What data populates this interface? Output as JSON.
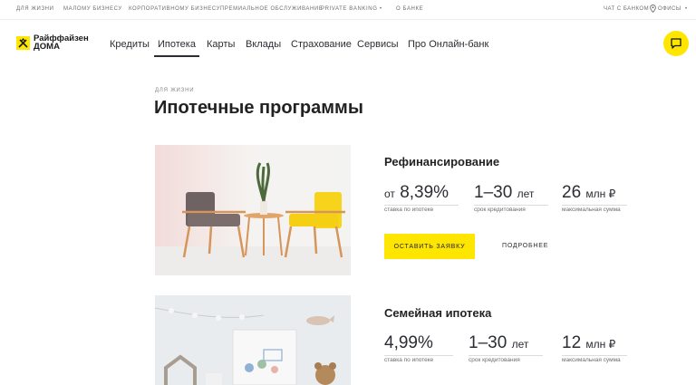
{
  "topbar": {
    "items": [
      "Для жизни",
      "Малому бизнесу",
      "Корпоративному бизнесу",
      "Премиальное обслуживание",
      "Private Banking",
      "•",
      "О банке"
    ],
    "chat": "Чат с банком",
    "offices": "Офисы",
    "more": "•"
  },
  "logo": {
    "line1": "Райффайзен",
    "line2": "ДОМА"
  },
  "nav": {
    "items": [
      "Кредиты",
      "Ипотека",
      "Карты",
      "Вклады",
      "Страхование",
      "Сервисы",
      "Про Онлайн-банк"
    ],
    "active": "Ипотека"
  },
  "breadcrumb": "Для жизни",
  "page_title": "Ипотечные программы",
  "programs": [
    {
      "title": "Рефинансирование",
      "stats": [
        {
          "prefix": "от",
          "value": "8,39%",
          "unit": "",
          "label": "ставка по ипотеке"
        },
        {
          "prefix": "",
          "value": "1–30",
          "unit": "лет",
          "label": "срок кредитования"
        },
        {
          "prefix": "",
          "value": "26",
          "unit": "млн ₽",
          "label": "максимальная сумма"
        }
      ],
      "apply_label": "Оставить заявку",
      "more_label": "Подробнее"
    },
    {
      "title": "Семейная ипотека",
      "stats": [
        {
          "prefix": "",
          "value": "4,99%",
          "unit": "",
          "label": "ставка по ипотеке"
        },
        {
          "prefix": "",
          "value": "1–30",
          "unit": "лет",
          "label": "срок кредитования"
        },
        {
          "prefix": "",
          "value": "12",
          "unit": "млн ₽",
          "label": "максимальная сумма"
        }
      ]
    }
  ],
  "colors": {
    "accent": "#fee600",
    "text": "#2b2d33",
    "muted": "#6b6d72"
  }
}
